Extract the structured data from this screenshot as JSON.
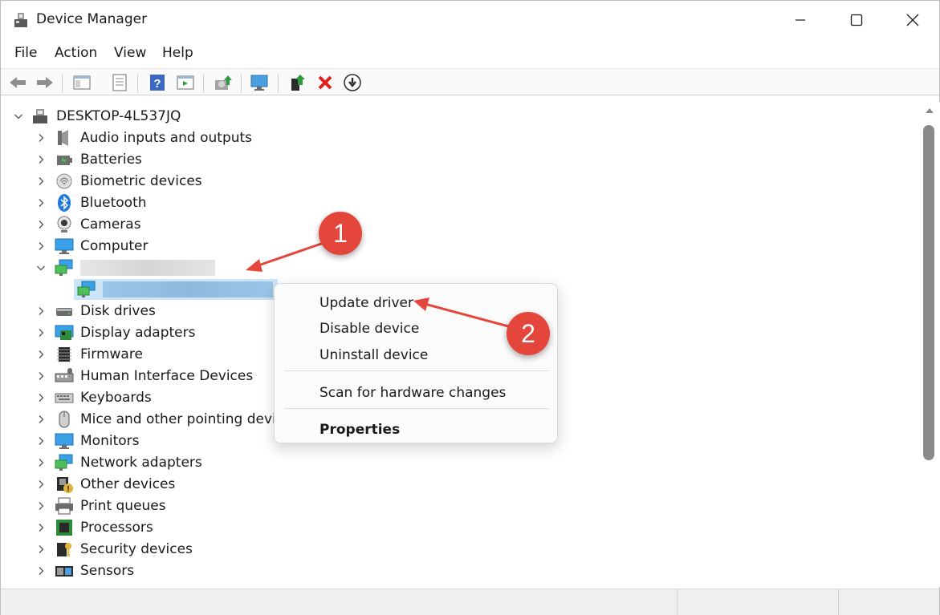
{
  "window": {
    "title": "Device Manager",
    "controls": {
      "minimize": "—",
      "maximize": "☐",
      "close": "✕"
    }
  },
  "menubar": [
    {
      "label": "File"
    },
    {
      "label": "Action"
    },
    {
      "label": "View"
    },
    {
      "label": "Help"
    }
  ],
  "toolbar": [
    {
      "name": "back-icon"
    },
    {
      "name": "forward-icon"
    },
    {
      "name": "show-hide-console-tree-icon"
    },
    {
      "name": "properties-icon"
    },
    {
      "name": "help-icon"
    },
    {
      "name": "action-pane-icon"
    },
    {
      "name": "update-driver-icon"
    },
    {
      "name": "scan-hardware-icon"
    },
    {
      "name": "enable-device-icon"
    },
    {
      "name": "uninstall-device-icon"
    },
    {
      "name": "disable-device-icon"
    }
  ],
  "tree": {
    "root": {
      "label": "DESKTOP-4L537JQ",
      "expanded": true
    },
    "items": [
      {
        "label": "Audio inputs and outputs",
        "icon": "speaker-icon"
      },
      {
        "label": "Batteries",
        "icon": "battery-icon"
      },
      {
        "label": "Biometric devices",
        "icon": "fingerprint-icon"
      },
      {
        "label": "Bluetooth",
        "icon": "bluetooth-icon"
      },
      {
        "label": "Cameras",
        "icon": "camera-icon"
      },
      {
        "label": "Computer",
        "icon": "monitor-icon"
      },
      {
        "label": "",
        "icon": "network-icon",
        "expanded": true,
        "redacted": true
      },
      {
        "label": "",
        "icon": "network-icon",
        "child": true,
        "selected": true,
        "redacted": true
      },
      {
        "label": "Disk drives",
        "icon": "disk-drive-icon"
      },
      {
        "label": "Display adapters",
        "icon": "display-adapter-icon"
      },
      {
        "label": "Firmware",
        "icon": "chip-icon"
      },
      {
        "label": "Human Interface Devices",
        "icon": "hid-icon"
      },
      {
        "label": "Keyboards",
        "icon": "keyboard-icon"
      },
      {
        "label": "Mice and other pointing device",
        "icon": "mouse-icon"
      },
      {
        "label": "Monitors",
        "icon": "monitor-icon"
      },
      {
        "label": "Network adapters",
        "icon": "network-icon"
      },
      {
        "label": "Other devices",
        "icon": "unknown-device-icon"
      },
      {
        "label": "Print queues",
        "icon": "printer-icon"
      },
      {
        "label": "Processors",
        "icon": "processor-icon"
      },
      {
        "label": "Security devices",
        "icon": "key-icon"
      },
      {
        "label": "Sensors",
        "icon": "sensor-icon"
      }
    ]
  },
  "context_menu": {
    "items": [
      {
        "label": "Update driver"
      },
      {
        "label": "Disable device"
      },
      {
        "label": "Uninstall device"
      },
      {
        "label": "Scan for hardware changes"
      },
      {
        "label": "Properties",
        "bold": true
      }
    ]
  },
  "annotations": [
    {
      "number": "1"
    },
    {
      "number": "2"
    }
  ],
  "colors": {
    "accent": "#e4463b",
    "selection": "#cce4f7",
    "scroll_thumb": "#8a8a8a"
  }
}
